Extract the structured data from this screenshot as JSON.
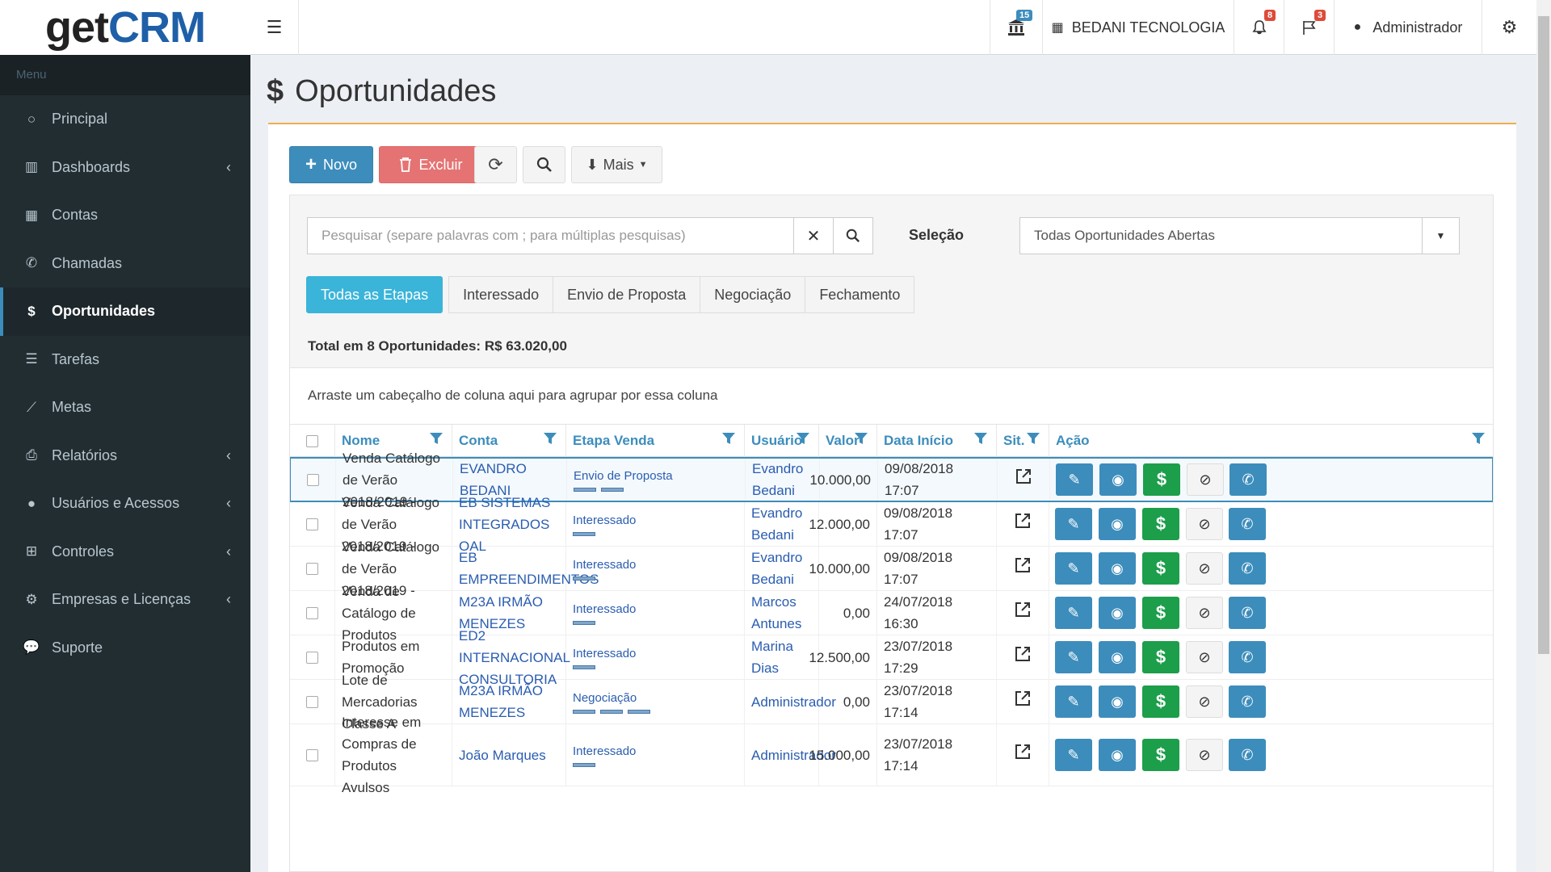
{
  "brand": {
    "logo_get": "get",
    "logo_crm": "CRM"
  },
  "sidebar": {
    "header": "Menu",
    "items": [
      {
        "label": "Principal",
        "icon": "circle-icon",
        "glyph": "○"
      },
      {
        "label": "Dashboards",
        "icon": "bar-chart-icon",
        "glyph": "▥",
        "chevron": "‹"
      },
      {
        "label": "Contas",
        "icon": "building-icon",
        "glyph": "▦"
      },
      {
        "label": "Chamadas",
        "icon": "phone-icon",
        "glyph": "✆"
      },
      {
        "label": "Oportunidades",
        "icon": "dollar-icon",
        "glyph": "$"
      },
      {
        "label": "Tarefas",
        "icon": "list-icon",
        "glyph": "☰"
      },
      {
        "label": "Metas",
        "icon": "line-chart-icon",
        "glyph": "⟋"
      },
      {
        "label": "Relatórios",
        "icon": "print-icon",
        "glyph": "⎙",
        "chevron": "‹"
      },
      {
        "label": "Usuários e Acessos",
        "icon": "user-icon",
        "glyph": "●",
        "chevron": "‹"
      },
      {
        "label": "Controles",
        "icon": "plus-square-icon",
        "glyph": "⊞",
        "chevron": "‹"
      },
      {
        "label": "Empresas e Licenças",
        "icon": "cog-icon",
        "glyph": "⚙",
        "chevron": "‹"
      },
      {
        "label": "Suporte",
        "icon": "comments-icon",
        "glyph": "💬"
      }
    ]
  },
  "topbar": {
    "bank_badge": "15",
    "company": "BEDANI TECNOLOGIA",
    "bell_badge": "8",
    "flag_badge": "3",
    "user": "Administrador"
  },
  "page": {
    "title": "Oportunidades"
  },
  "toolbar": {
    "new_label": "Novo",
    "delete_label": "Excluir",
    "more_label": "Mais"
  },
  "filters": {
    "search_placeholder": "Pesquisar (separe palavras com ; para múltiplas pesquisas)",
    "selection_label": "Seleção",
    "selection_value": "Todas Oportunidades Abertas",
    "stages": [
      "Todas as Etapas",
      "Interessado",
      "Envio de Proposta",
      "Negociação",
      "Fechamento"
    ],
    "total": "Total em 8 Oportunidades: R$ 63.020,00"
  },
  "grid": {
    "group_hint": "Arraste um cabeçalho de coluna aqui para agrupar por essa coluna",
    "columns": [
      "Nome",
      "Conta",
      "Etapa Venda",
      "Usuário",
      "Valor",
      "Data Início",
      "Sit.",
      "Ação"
    ],
    "rows": [
      {
        "nome": "Venda Catálogo de Verão 2018/2019 -",
        "conta": "EVANDRO BEDANI",
        "etapa": "Envio de Proposta",
        "bars": 2,
        "usuario": "Evandro Bedani",
        "valor": "10.000,00",
        "data": "09/08/2018 17:07"
      },
      {
        "nome": "Venda Catálogo de Verão 2018/2019 -",
        "conta": "EB SISTEMAS INTEGRADOS OAL",
        "etapa": "Interessado",
        "bars": 1,
        "usuario": "Evandro Bedani",
        "valor": "12.000,00",
        "data": "09/08/2018 17:07"
      },
      {
        "nome": "Venda Catálogo de Verão 2018/2019 -",
        "conta": "EB EMPREENDIMENTOS",
        "etapa": "Interessado",
        "bars": 1,
        "usuario": "Evandro Bedani",
        "valor": "10.000,00",
        "data": "09/08/2018 17:07"
      },
      {
        "nome": "Venda de Catálogo de Produtos",
        "conta": "M23A IRMÃO MENEZES",
        "etapa": "Interessado",
        "bars": 1,
        "usuario": "Marcos Antunes",
        "valor": "0,00",
        "data": "24/07/2018 16:30"
      },
      {
        "nome": "Produtos em Promoção",
        "conta": "ED2 INTERNACIONAL CONSULTORIA",
        "etapa": "Interessado",
        "bars": 1,
        "usuario": "Marina Dias",
        "valor": "12.500,00",
        "data": "23/07/2018 17:29"
      },
      {
        "nome": "Lote de Mercadorias Classe A",
        "conta": "M23A IRMÃO MENEZES",
        "etapa": "Negociação",
        "bars": 3,
        "usuario": "Administrador",
        "valor": "0,00",
        "data": "23/07/2018 17:14"
      },
      {
        "nome": "Interesse em Compras de Produtos Avulsos",
        "conta": "João Marques",
        "etapa": "Interessado",
        "bars": 1,
        "usuario": "Administrador",
        "valor": "15.000,00",
        "data": "23/07/2018 17:14"
      }
    ]
  },
  "colors": {
    "primary": "#3c8dbc",
    "sidebar": "#222d32",
    "success": "#1c9e4a",
    "danger": "#e57373",
    "info": "#3ab4d9"
  }
}
